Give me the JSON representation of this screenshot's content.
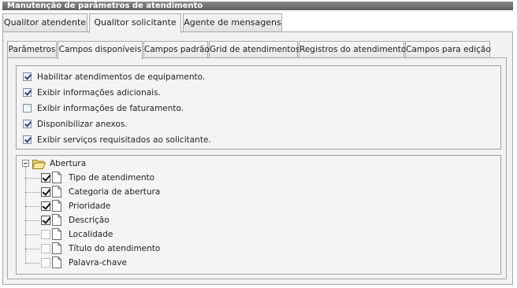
{
  "window": {
    "title": "Manutenção de parâmetros de atendimento"
  },
  "main_tabs": [
    {
      "label": "Qualitor atendente",
      "active": false
    },
    {
      "label": "Qualitor solicitante",
      "active": true
    },
    {
      "label": "Agente de mensagens",
      "active": false
    }
  ],
  "sub_tabs": [
    {
      "label": "Parâmetros",
      "active": false
    },
    {
      "label": "Campos disponíveis",
      "active": true
    },
    {
      "label": "Campos padrão",
      "active": false
    },
    {
      "label": "Grid de atendimentos",
      "active": false
    },
    {
      "label": "Registros do atendimento",
      "active": false
    },
    {
      "label": "Campos para edição",
      "active": false
    }
  ],
  "options": [
    {
      "label": "Habilitar atendimentos de equipamento.",
      "checked": true
    },
    {
      "label": "Exibir informações adicionais.",
      "checked": true
    },
    {
      "label": "Exibir informações de faturamento.",
      "checked": false
    },
    {
      "label": "Disponibilizar anexos.",
      "checked": true
    },
    {
      "label": "Exibir serviços requisitados ao solicitante.",
      "checked": true
    }
  ],
  "tree": {
    "root_label": "Abertura",
    "nodes": [
      {
        "label": "Tipo de atendimento",
        "checked": true
      },
      {
        "label": "Categoria de abertura",
        "checked": true
      },
      {
        "label": "Prioridade",
        "checked": true
      },
      {
        "label": "Descrição",
        "checked": true
      },
      {
        "label": "Localidade",
        "checked": false
      },
      {
        "label": "Título do atendimento",
        "checked": false
      },
      {
        "label": "Palavra-chave",
        "checked": false
      }
    ]
  },
  "colors": {
    "titlebar": "#6e6e6e",
    "panel": "#f2f2f2",
    "border": "#a7a7a7"
  },
  "icons": {
    "expander": "minus-icon",
    "folder": "folder-open-icon",
    "node": "document-icon"
  }
}
